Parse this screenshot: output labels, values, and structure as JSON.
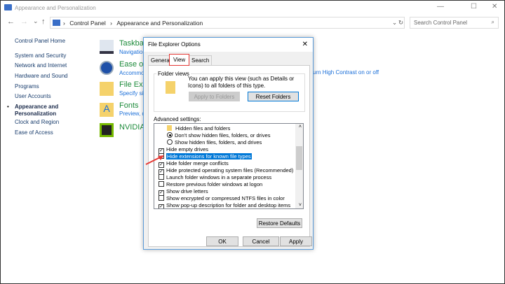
{
  "window": {
    "title": "Appearance and Personalization",
    "minimize": "—",
    "maximize": "☐",
    "close": "✕"
  },
  "address": {
    "back": "←",
    "forward": "→",
    "recent": "⌄",
    "up": "↑",
    "crumbs": [
      "Control Panel",
      "Appearance and Personalization"
    ],
    "sep": "›",
    "dropdown": "⌄",
    "refresh": "↻"
  },
  "search": {
    "placeholder": "Search Control Panel",
    "icon": "⌕"
  },
  "nav": {
    "items": [
      "Control Panel Home",
      "System and Security",
      "Network and Internet",
      "Hardware and Sound",
      "Programs",
      "User Accounts",
      "Appearance and Personalization",
      "Clock and Region",
      "Ease of Access"
    ],
    "active_line1": "Appearance and",
    "active_line2": "Personalization"
  },
  "categories": [
    {
      "title": "Taskbar",
      "link": "Navigation"
    },
    {
      "title": "Ease of",
      "link": "Accommo"
    },
    {
      "title": "File Exp",
      "link": "Specify si"
    },
    {
      "title": "Fonts",
      "link": "Preview, d"
    },
    {
      "title": "NVIDIA",
      "link": ""
    }
  ],
  "high_contrast_link": "urn High Contrast on or off",
  "dialog": {
    "title": "File Explorer Options",
    "close": "✕",
    "tabs": [
      "General",
      "View",
      "Search"
    ],
    "folder_views": {
      "label": "Folder views",
      "text": "You can apply this view (such as Details or Icons) to all folders of this type.",
      "apply": "Apply to Folders",
      "reset": "Reset Folders"
    },
    "advanced_label": "Advanced settings:",
    "settings": [
      {
        "type": "folder",
        "label": "Hidden files and folders"
      },
      {
        "type": "radio",
        "checked": true,
        "label": "Don't show hidden files, folders, or drives"
      },
      {
        "type": "radio",
        "checked": false,
        "label": "Show hidden files, folders, and drives"
      },
      {
        "type": "check",
        "checked": true,
        "label": "Hide empty drives"
      },
      {
        "type": "check",
        "checked": false,
        "label": "Hide extensions for known file types",
        "selected": true
      },
      {
        "type": "check",
        "checked": true,
        "label": "Hide folder merge conflicts"
      },
      {
        "type": "check",
        "checked": true,
        "label": "Hide protected operating system files (Recommended)"
      },
      {
        "type": "check",
        "checked": false,
        "label": "Launch folder windows in a separate process"
      },
      {
        "type": "check",
        "checked": false,
        "label": "Restore previous folder windows at logon"
      },
      {
        "type": "check",
        "checked": true,
        "label": "Show drive letters"
      },
      {
        "type": "check",
        "checked": false,
        "label": "Show encrypted or compressed NTFS files in color"
      },
      {
        "type": "check",
        "checked": true,
        "label": "Show pop-up description for folder and desktop items"
      }
    ],
    "restore": "Restore Defaults",
    "ok": "OK",
    "cancel": "Cancel",
    "apply": "Apply"
  },
  "colors": {
    "accent": "#0078d7",
    "highlight": "#e53935",
    "link": "#1a6ed8",
    "category": "#1c8a3a"
  }
}
